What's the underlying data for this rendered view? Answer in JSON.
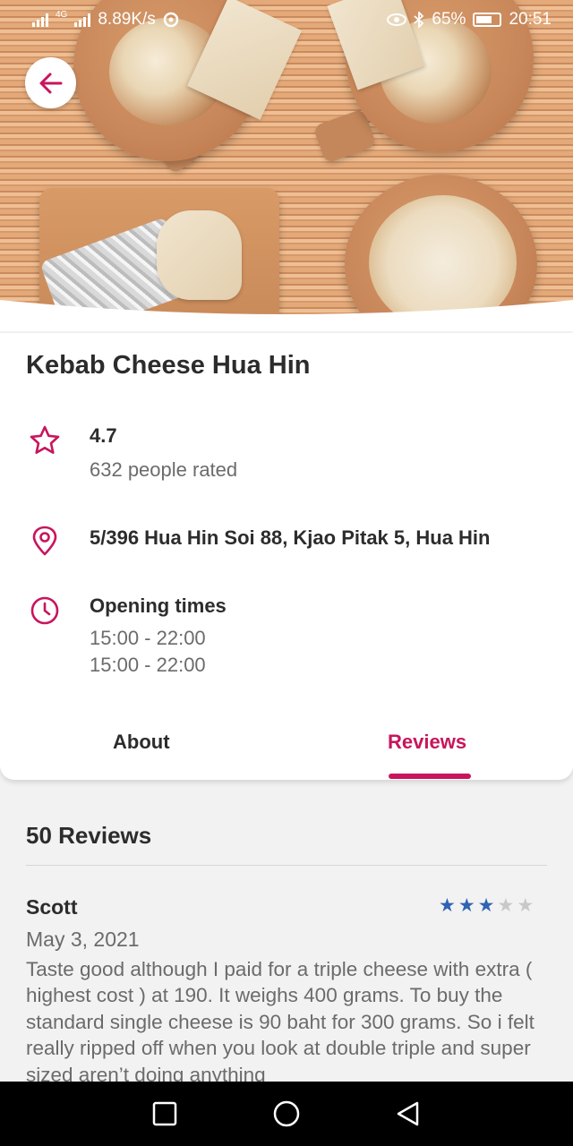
{
  "status_bar": {
    "network_speed": "8.89K/s",
    "network_type": "4G",
    "battery": "65%",
    "time": "20:51",
    "icons": [
      "signal-icon",
      "sync-icon",
      "eye-icon",
      "bluetooth-icon",
      "battery-icon"
    ]
  },
  "restaurant": {
    "name": "Kebab Cheese Hua Hin",
    "rating": "4.7",
    "rated_count": "632 people rated",
    "address": "5/396 Hua Hin Soi 88, Kjao Pitak 5, Hua Hin",
    "opening_title": "Opening times",
    "opening_hours": [
      "15:00 - 22:00",
      "15:00 - 22:00"
    ]
  },
  "tabs": {
    "about": "About",
    "reviews": "Reviews",
    "active": "reviews"
  },
  "reviews": {
    "count_label": "50 Reviews",
    "items": [
      {
        "author": "Scott",
        "stars": 3,
        "max_stars": 5,
        "date": "May 3, 2021",
        "text": "Taste good although I paid for a triple cheese with extra ( highest cost ) at 190. It weighs 400 grams. To buy the standard single cheese is 90 baht for 300 grams. So i felt really ripped off when you look at double triple and super sized aren’t doing anything"
      }
    ]
  },
  "colors": {
    "accent": "#c8155d",
    "star_on": "#2f64b3",
    "star_off": "#c8c8c8"
  }
}
